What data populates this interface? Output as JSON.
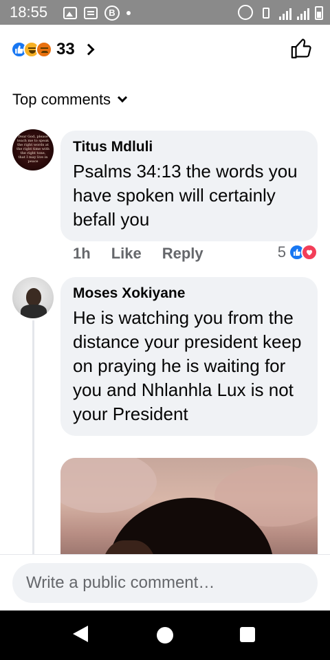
{
  "status_bar": {
    "time": "18:55",
    "left_icons": [
      "image-notification-icon",
      "message-notification-icon",
      "b-circle-icon",
      "dot-icon"
    ],
    "right_icons": [
      "alarm-icon",
      "vibrate-icon",
      "signal-icon",
      "signal-icon",
      "battery-icon"
    ]
  },
  "post_header": {
    "reaction_icons": [
      "like-icon",
      "haha-icon",
      "angry-icon"
    ],
    "reaction_count": "33",
    "like_button_icon": "thumbs-up-outline-icon"
  },
  "sort": {
    "label": "Top comments"
  },
  "comments": [
    {
      "author": "Titus Mdluli",
      "text": "Psalms 34:13 the words you have spoken will certainly befall you",
      "time": "1h",
      "like_label": "Like",
      "reply_label": "Reply",
      "reaction_count": "5",
      "reactions": [
        "like-icon",
        "love-icon"
      ],
      "avatar_text": "Dear God, please teach me to speak the right words at the right time with the right tone, that I may live in peace"
    },
    {
      "author": "Moses Xokiyane",
      "text": "He is watching you from the distance your president keep on praying he is waiting for you and Nhlanhla Lux is not your President",
      "has_photo": true
    }
  ],
  "composer": {
    "placeholder": "Write a public comment…"
  },
  "nav_bar": {
    "buttons": [
      "back-icon",
      "home-icon",
      "recents-icon"
    ]
  },
  "colors": {
    "accent": "#1877f2",
    "love": "#f33e58",
    "haha": "#f7b125",
    "angry": "#e9710f",
    "bubble": "#f0f2f5",
    "status_bar": "#8a8a8a"
  }
}
